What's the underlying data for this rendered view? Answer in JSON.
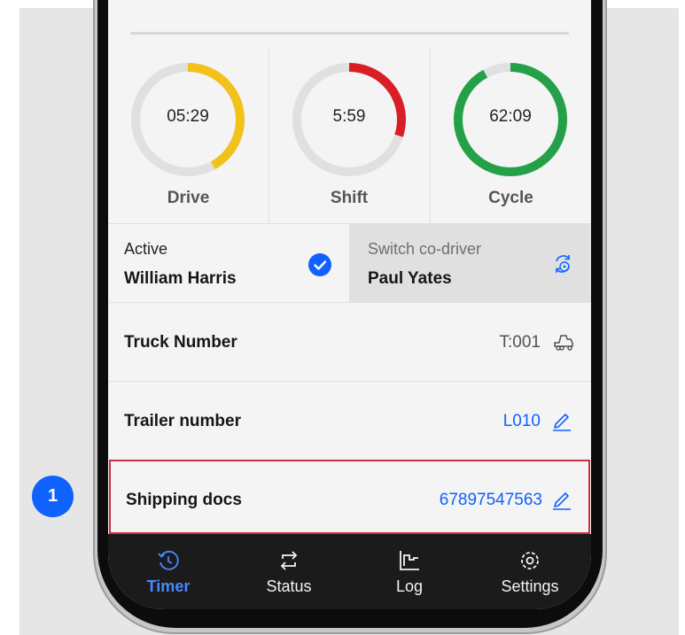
{
  "gauges": [
    {
      "label": "Drive",
      "value": "05:29",
      "fraction": 0.42,
      "color": "#f1c21b"
    },
    {
      "label": "Shift",
      "value": "5:59",
      "fraction": 0.3,
      "color": "#da1e28"
    },
    {
      "label": "Cycle",
      "value": "62:09",
      "fraction": 0.92,
      "color": "#24a148"
    }
  ],
  "gauge_track_color": "#e0e0e0",
  "drivers": {
    "active_caption": "Active",
    "active_name": "William Harris",
    "switch_caption": "Switch co-driver",
    "co_driver_name": "Paul Yates"
  },
  "rows": {
    "truck": {
      "label": "Truck Number",
      "value": "T:001",
      "icon": "truck-icon"
    },
    "trailer": {
      "label": "Trailer number",
      "value": "L010",
      "icon": "edit-icon"
    },
    "shipping": {
      "label": "Shipping docs",
      "value": "67897547563",
      "icon": "edit-icon"
    }
  },
  "tabs": [
    {
      "label": "Timer",
      "icon": "timer-icon",
      "active": true
    },
    {
      "label": "Status",
      "icon": "status-swap-icon",
      "active": false
    },
    {
      "label": "Log",
      "icon": "log-chart-icon",
      "active": false
    },
    {
      "label": "Settings",
      "icon": "gear-icon",
      "active": false
    }
  ],
  "annotation": {
    "step_number": "1"
  },
  "colors": {
    "accent": "#0f62fe",
    "highlight_border": "#c9303e",
    "tabbar_bg": "#1b1b1b",
    "active_tab": "#4589ff"
  }
}
